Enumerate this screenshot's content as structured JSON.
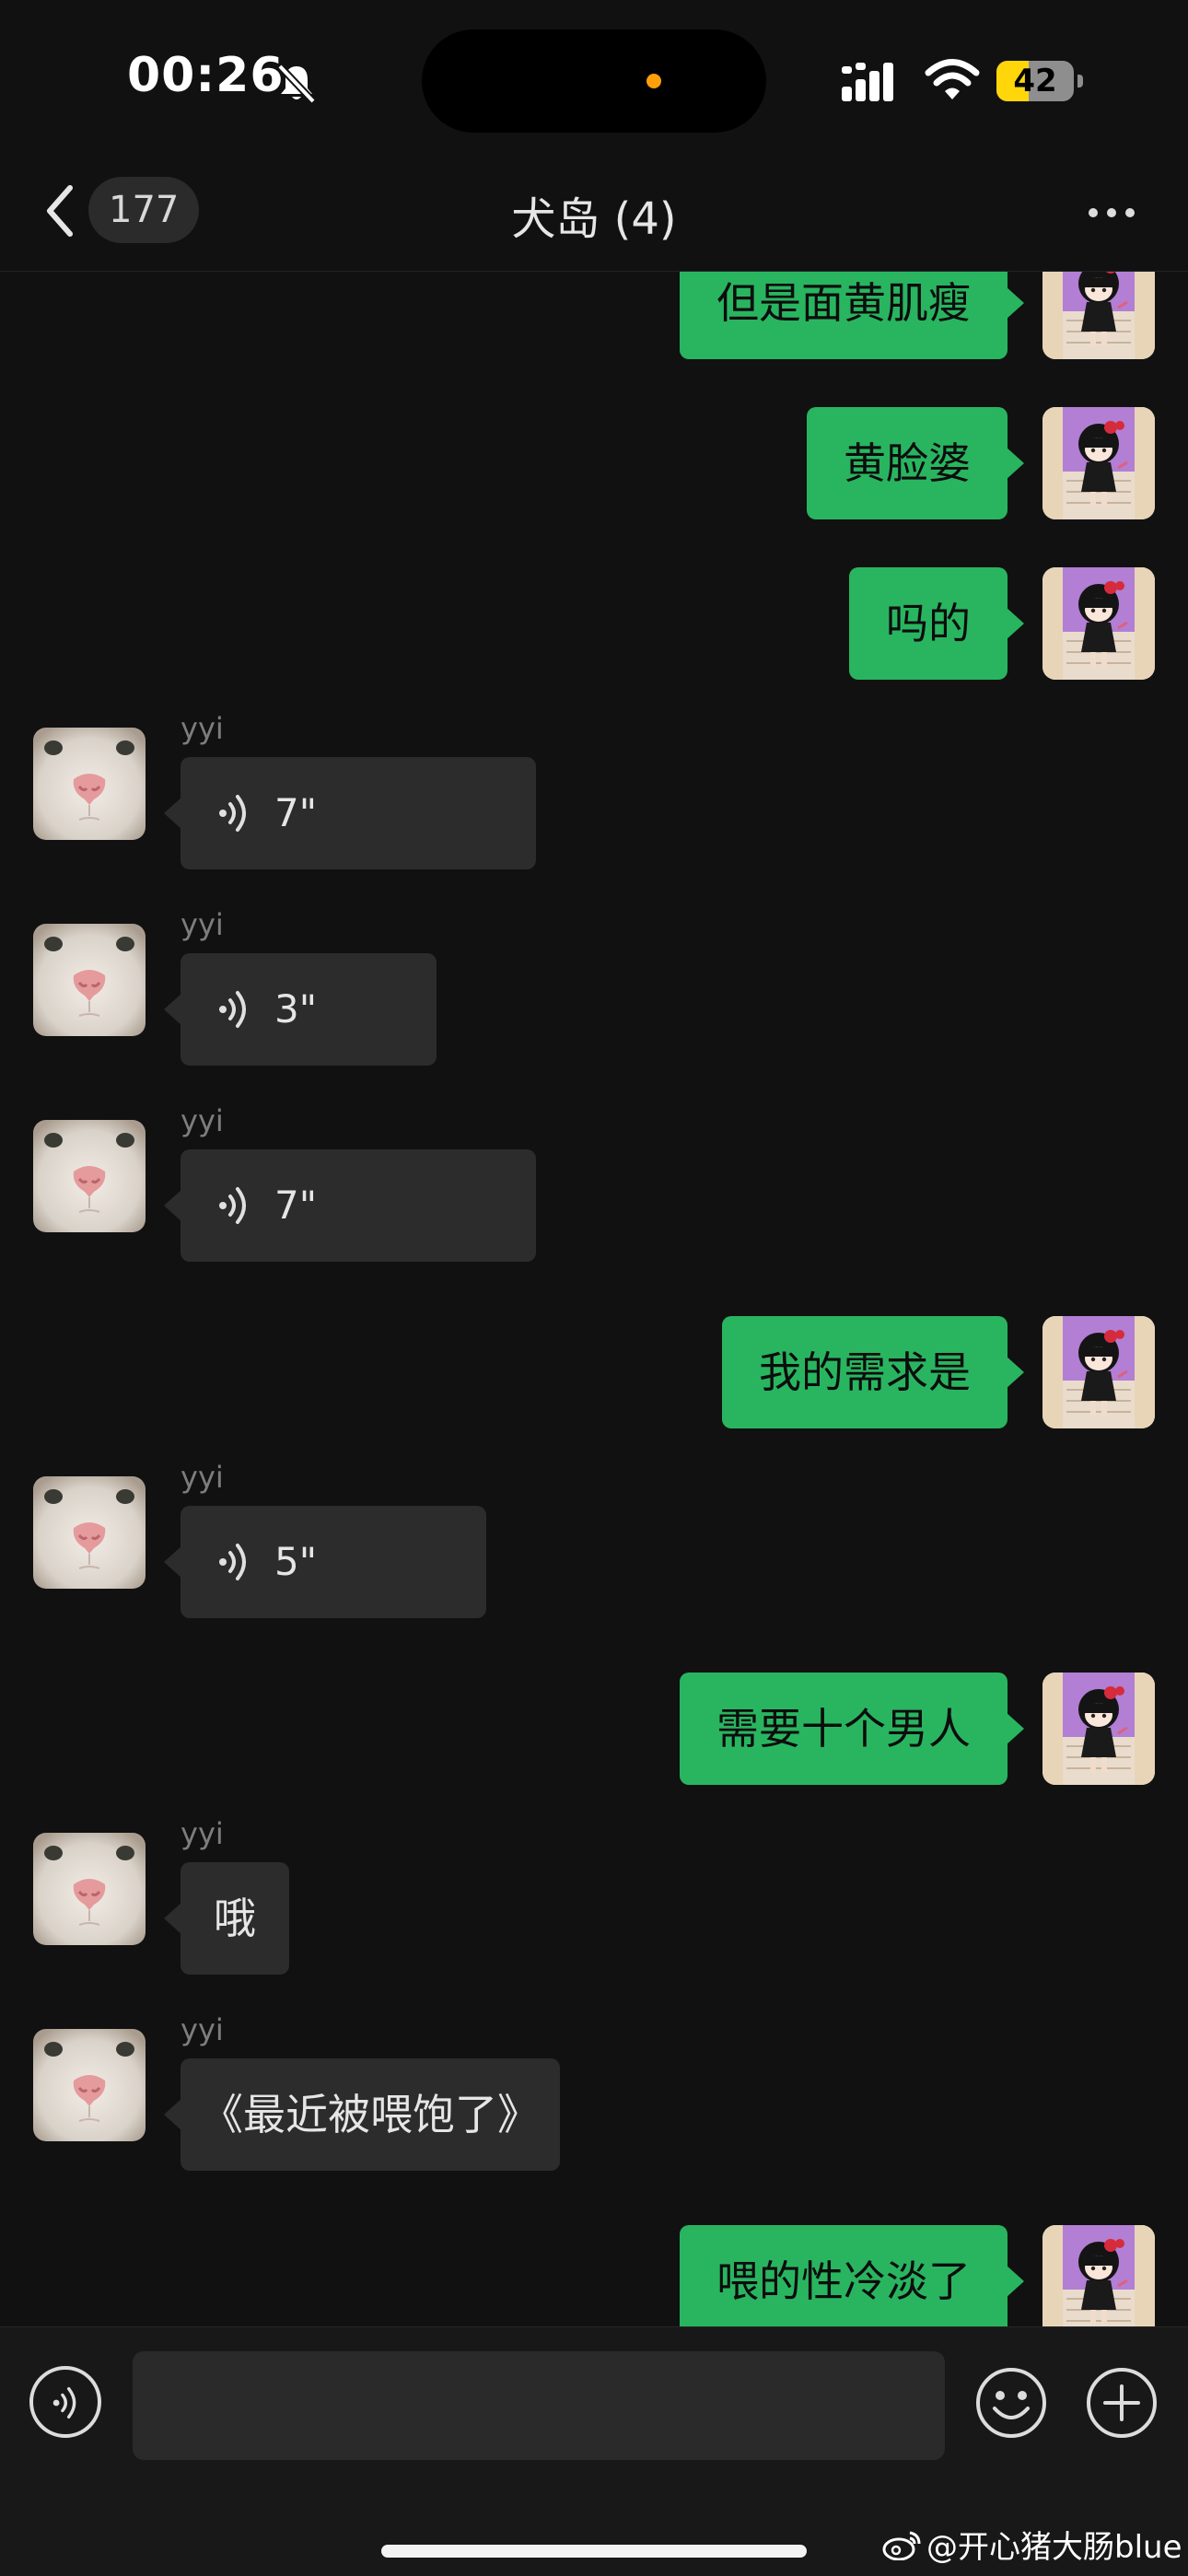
{
  "status_bar": {
    "time": "00:26",
    "battery": "42",
    "battery_level": 0.42,
    "icons": [
      "bell-slash-icon",
      "signal-icon",
      "wifi-icon",
      "battery-icon"
    ]
  },
  "nav": {
    "unread_count": "177",
    "title": "犬岛 (4)",
    "icons": [
      "chevron-left-icon",
      "more-dots-icon"
    ]
  },
  "messages": [
    {
      "side": "out",
      "text": "但是面黄肌瘦"
    },
    {
      "side": "out",
      "text": "黄脸婆"
    },
    {
      "side": "out",
      "text": "吗的"
    },
    {
      "side": "in",
      "sender": "yyi",
      "type": "voice",
      "duration": "7\""
    },
    {
      "side": "in",
      "sender": "yyi",
      "type": "voice",
      "duration": "3\""
    },
    {
      "side": "in",
      "sender": "yyi",
      "type": "voice",
      "duration": "7\""
    },
    {
      "side": "out",
      "text": "我的需求是"
    },
    {
      "side": "in",
      "sender": "yyi",
      "type": "voice",
      "duration": "5\""
    },
    {
      "side": "out",
      "text": "需要十个男人"
    },
    {
      "side": "in",
      "sender": "yyi",
      "type": "text",
      "text": "哦"
    },
    {
      "side": "in",
      "sender": "yyi",
      "type": "text",
      "text": "《最近被喂饱了》"
    },
    {
      "side": "out",
      "text": "喂的性冷淡了"
    }
  ],
  "input_bar": {
    "placeholder": "",
    "icons": [
      "voice-input-icon",
      "emoji-icon",
      "plus-icon"
    ]
  },
  "watermark": {
    "text": "@开心猪大肠blue",
    "icon": "weibo-logo-icon"
  },
  "colors": {
    "background": "#111111",
    "outgoing_bubble": "#29b560",
    "incoming_bubble": "#2c2c2c",
    "battery_fill": "#ffd60a",
    "camera_dot": "#ff9f0a"
  }
}
